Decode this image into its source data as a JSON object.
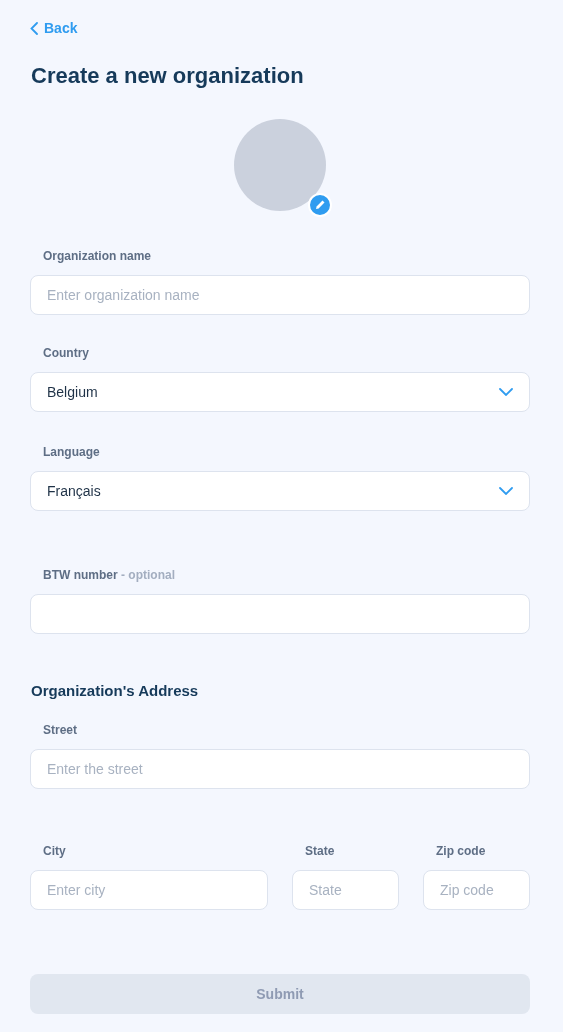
{
  "back": {
    "label": "Back"
  },
  "title": "Create a new organization",
  "avatar": {
    "editable": true
  },
  "fields": [
    {
      "kind": "text",
      "label": "Organization name",
      "placeholder": "Enter organization name"
    },
    {
      "kind": "select",
      "label": "Country",
      "value": "Belgium"
    },
    {
      "kind": "select",
      "label": "Language",
      "value": "Français"
    },
    {
      "kind": "text",
      "label": "BTW number",
      "hint": "- optional"
    }
  ],
  "address": {
    "heading": "Organization's Address",
    "fields": [
      {
        "kind": "text",
        "label": "Street",
        "placeholder": "Enter the street"
      }
    ],
    "row": [
      {
        "kind": "text",
        "label": "City",
        "placeholder": "Enter city"
      },
      {
        "kind": "text",
        "label": "State",
        "placeholder": "State"
      },
      {
        "kind": "text",
        "label": "Zip code",
        "placeholder": "Zip code"
      }
    ]
  },
  "submit": {
    "label": "Submit",
    "disabled": true
  }
}
